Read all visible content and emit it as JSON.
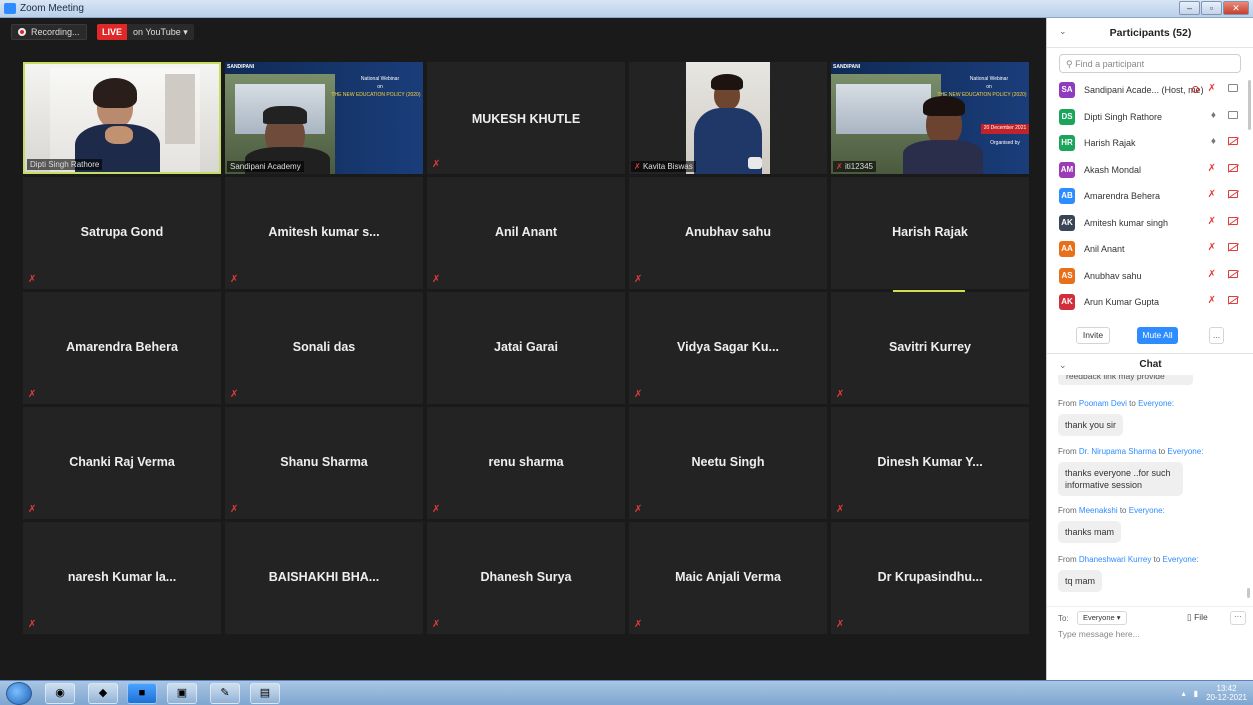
{
  "window": {
    "title": "Zoom Meeting",
    "buttons": [
      "–",
      "▫",
      "✕"
    ]
  },
  "toolbar": {
    "recording_label": "Recording...",
    "live_badge": "LIVE",
    "live_label": "on YouTube ▾"
  },
  "tiles_video": [
    {
      "label": "Dipti Singh Rathore",
      "active": true
    },
    {
      "label": "Sandipani Academy"
    },
    {
      "name": "MUKESH KHUTLE"
    },
    {
      "label": "Kavita Biswas"
    },
    {
      "label": "iti12345"
    }
  ],
  "tiles": [
    [
      "Satrupa Gond",
      "Amitesh kumar s...",
      "Anil Anant",
      "Anubhav sahu",
      "Harish Rajak"
    ],
    [
      "Amarendra Behera",
      "Sonali das",
      "Jatai Garai",
      "Vidya Sagar Ku...",
      "Savitri Kurrey"
    ],
    [
      "Chanki Raj Verma",
      "Shanu Sharma",
      "renu sharma",
      "Neetu Singh",
      "Dinesh Kumar Y..."
    ],
    [
      "naresh Kumar la...",
      "BAISHAKHI BHA...",
      "Dhanesh Surya",
      "Maic Anjali Verma",
      "Dr Krupasindhu..."
    ]
  ],
  "slide": {
    "brand": "SANDIPANI",
    "line1": "National Webinar",
    "line2": "on",
    "line3": "THE NEW EDUCATION POLICY (2020)",
    "line4": "20 December 2021",
    "line5": "Organised by"
  },
  "participants": {
    "title": "Participants (52)",
    "search_placeholder": "Find a participant",
    "list": [
      {
        "initials": "SA",
        "name": "Sandipani Acade... (Host, me)",
        "color": "#8e3bbf"
      },
      {
        "initials": "DS",
        "name": "Dipti Singh Rathore",
        "color": "#1aa55a"
      },
      {
        "initials": "HR",
        "name": "Harish Rajak",
        "color": "#1aa55a"
      },
      {
        "initials": "AM",
        "name": "Akash Mondal",
        "color": "#9b3bb8"
      },
      {
        "initials": "AB",
        "name": "Amarendra Behera",
        "color": "#2d8cff"
      },
      {
        "initials": "AK",
        "name": "Amitesh kumar singh",
        "color": "#3a4556"
      },
      {
        "initials": "AA",
        "name": "Anil Anant",
        "color": "#e8701a"
      },
      {
        "initials": "AS",
        "name": "Anubhav sahu",
        "color": "#e8701a"
      },
      {
        "initials": "AK",
        "name": "Arun Kumar Gupta",
        "color": "#d12f3a"
      }
    ],
    "invite": "Invite",
    "mute_all": "Mute All",
    "more": "..."
  },
  "chat": {
    "title": "Chat",
    "partial": "reedback link may provide",
    "messages": [
      {
        "from": "Poonam Devi",
        "to": "Everyone:",
        "text": "thank you sir"
      },
      {
        "from": "Dr. Nirupama Sharma",
        "to": "Everyone:",
        "text": "thanks everyone ..for such informative session"
      },
      {
        "from": "Meenakshi",
        "to": "Everyone:",
        "text": "thanks mam"
      },
      {
        "from": "Dhaneshwari Kurrey",
        "to": "Everyone:",
        "text": "tq mam"
      }
    ],
    "from_word": "From",
    "to_word": "to",
    "to_label": "To:",
    "to_value": "Everyone ▾",
    "file_label": "File",
    "more": "···",
    "input_placeholder": "Type message here..."
  },
  "taskbar": {
    "time": "13:42",
    "date": "20-12-2021"
  }
}
